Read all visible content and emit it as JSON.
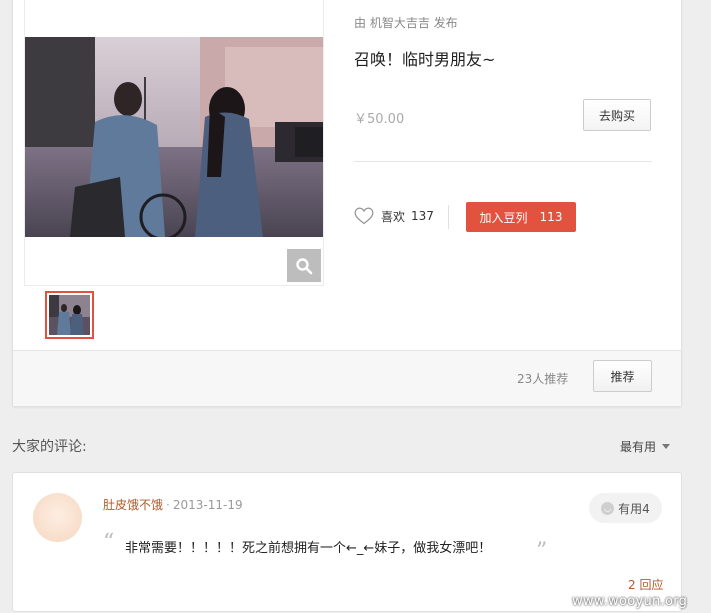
{
  "product": {
    "publisher": "由 机智大吉吉 发布",
    "title": "召唤！临时男朋友~",
    "price": "￥50.00",
    "buy_label": "去购买",
    "like_label": "喜欢",
    "like_count": "137",
    "doulist_label": "加入豆列",
    "doulist_count": "113",
    "recommend_count_text": "23人推荐",
    "recommend_label": "推荐"
  },
  "comments": {
    "title": "大家的评论:",
    "sort_label": "最有用",
    "items": [
      {
        "author": "肚皮饿不饿",
        "separator": "·",
        "date": "2013-11-19",
        "useful_label": "有用4",
        "text": "非常需要！！！！！死之前想拥有一个←_←妹子，做我女漂吧！",
        "replies": "2 回应"
      }
    ]
  },
  "watermark": "www.wooyun.org",
  "colors": {
    "accent": "#e2533f",
    "author": "#b05a2a",
    "background": "#eeeeee"
  }
}
